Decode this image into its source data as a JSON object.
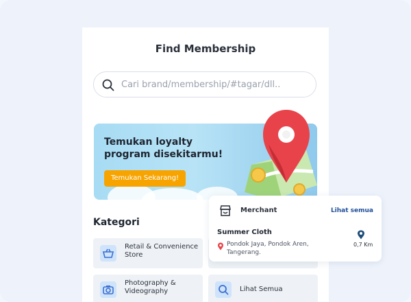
{
  "header": {
    "title": "Find Membership"
  },
  "search": {
    "placeholder": "Cari brand/membership/#tagar/dll.."
  },
  "banner": {
    "heading": "Temukan loyalty program disekitarmu!",
    "cta_label": "Temukan Sekarang!"
  },
  "categories": {
    "title": "Kategori",
    "items": [
      {
        "label": "Retail & Convenience Store",
        "icon": "basket-icon"
      },
      {
        "label": "Photography & Videography",
        "icon": "camera-icon"
      },
      {
        "label": "Lihat Semua",
        "icon": "search-icon"
      }
    ]
  },
  "merchant_card": {
    "header_label": "Merchant",
    "see_all_label": "Lihat semua",
    "merchant_name": "Summer Cloth",
    "address": "Pondok Jaya, Pondok Aren, Tangerang.",
    "distance": "0,7 Km"
  },
  "colors": {
    "accent_orange": "#F7A400",
    "link_blue": "#1F4E99",
    "pin_red": "#E8434A",
    "category_bg": "#EEF2F6"
  }
}
